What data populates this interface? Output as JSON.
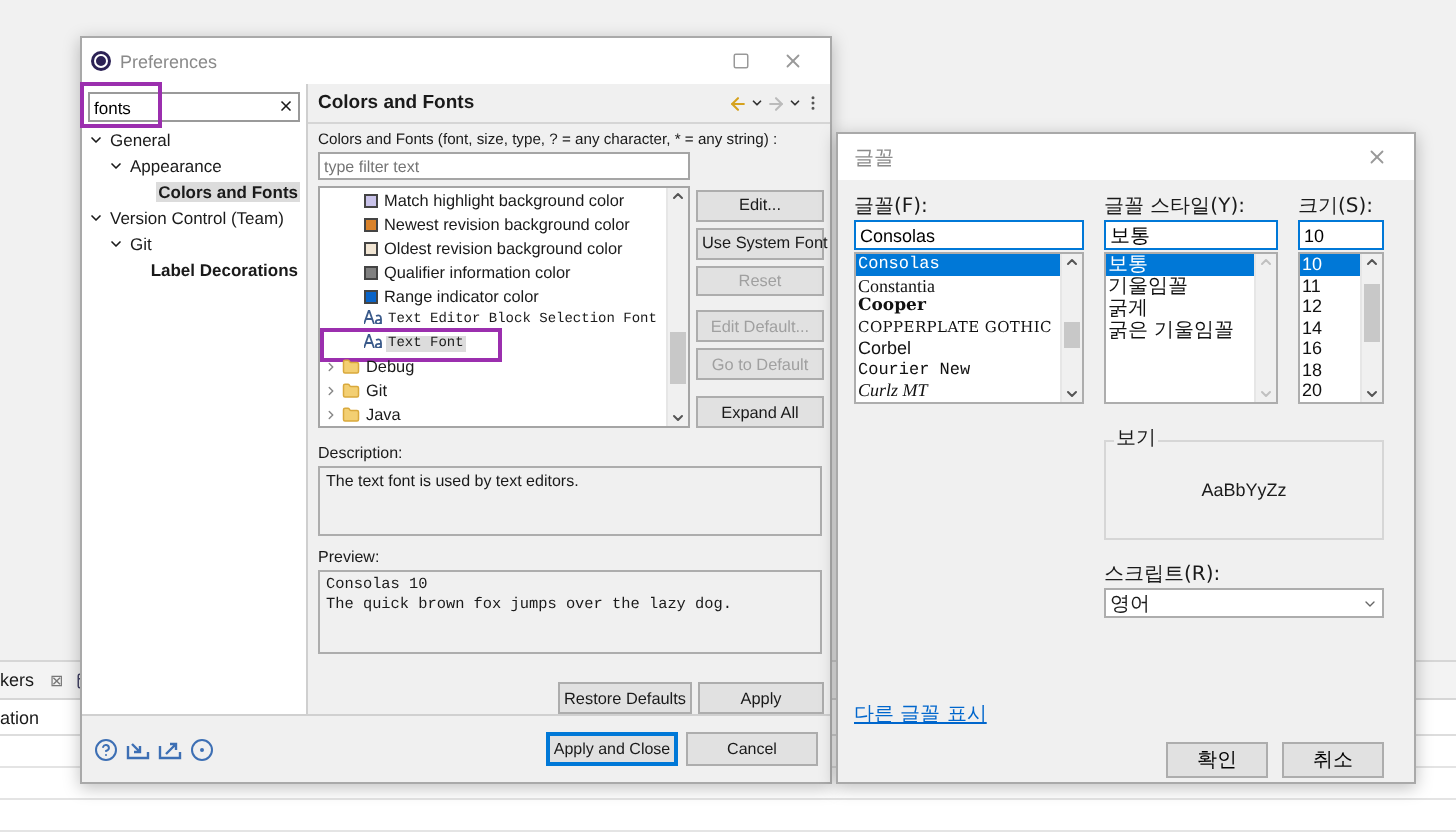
{
  "background": {
    "view_tab": {
      "label": "kers",
      "close": "⊠"
    },
    "table": {
      "columns": [
        "ation"
      ]
    }
  },
  "preferences": {
    "title": "Preferences",
    "search": {
      "value": "fonts",
      "highlighted": true
    },
    "nav_tree": [
      {
        "label": "General",
        "expanded": true,
        "children": [
          {
            "label": "Appearance",
            "expanded": true,
            "children": [
              {
                "label": "Colors and Fonts",
                "selected": true
              }
            ]
          }
        ]
      },
      {
        "label": "Version Control (Team)",
        "expanded": true,
        "children": [
          {
            "label": "Git",
            "expanded": true,
            "children": [
              {
                "label": "Label Decorations",
                "selected": false
              }
            ]
          }
        ]
      }
    ],
    "page_title": "Colors and Fonts",
    "instructions": "Colors and Fonts (font, size, type, ? = any character, * = any string) :",
    "filter": {
      "placeholder": "type filter text"
    },
    "items": [
      {
        "label": "Match highlight background color",
        "kind": "color",
        "color": "#c9c3ea",
        "selected": false,
        "highlighted": false
      },
      {
        "label": "Newest revision background color",
        "kind": "color",
        "color": "#d9822b",
        "selected": false,
        "highlighted": false
      },
      {
        "label": "Oldest revision background color",
        "kind": "color",
        "color": "#f2e6d4",
        "selected": false,
        "highlighted": false
      },
      {
        "label": "Qualifier information color",
        "kind": "color",
        "color": "#808080",
        "selected": false,
        "highlighted": false
      },
      {
        "label": "Range indicator color",
        "kind": "color",
        "color": "#0a64c8",
        "selected": false,
        "highlighted": false
      },
      {
        "label": "Text Editor Block Selection Font",
        "kind": "font",
        "selected": false,
        "highlighted": false
      },
      {
        "label": "Text Font",
        "kind": "font",
        "selected": true,
        "highlighted": true
      },
      {
        "label": "Debug",
        "kind": "category",
        "selected": false,
        "highlighted": false
      },
      {
        "label": "Git",
        "kind": "category",
        "selected": false,
        "highlighted": false
      },
      {
        "label": "Java",
        "kind": "category",
        "selected": false,
        "highlighted": false
      }
    ],
    "buttons": [
      {
        "label": "Edit...",
        "disabled": false
      },
      {
        "label": "Use System Font",
        "disabled": false
      },
      {
        "label": "Reset",
        "disabled": true
      },
      {
        "label": "Edit Default...",
        "disabled": true
      },
      {
        "label": "Go to Default",
        "disabled": true
      },
      {
        "label": "Expand All",
        "disabled": false
      }
    ],
    "description": {
      "label": "Description:",
      "text": "The text font is used by text editors."
    },
    "preview": {
      "label": "Preview:",
      "lines": [
        "Consolas 10",
        "The quick brown fox jumps over the lazy dog."
      ]
    },
    "page_buttons": [
      "Restore Defaults",
      "Apply"
    ],
    "dialog_buttons": [
      {
        "label": "Apply and Close",
        "default": true
      },
      {
        "label": "Cancel",
        "default": false
      }
    ]
  },
  "font_dialog": {
    "title": "글꼴",
    "font": {
      "label": "글꼴(F):",
      "value": "Consolas",
      "options": [
        {
          "label": "Consolas",
          "kind": "mono",
          "selected": true
        },
        {
          "label": "Constantia",
          "kind": "serif",
          "selected": false
        },
        {
          "label": "Cooper",
          "kind": "heavy",
          "selected": false
        },
        {
          "label": "COPPERPLATE GOTHIC",
          "kind": "wide",
          "selected": false
        },
        {
          "label": "Corbel",
          "kind": "sans",
          "selected": false
        },
        {
          "label": "Courier New",
          "kind": "mono",
          "selected": false
        },
        {
          "label": "Curlz MT",
          "kind": "script",
          "selected": false
        }
      ]
    },
    "style": {
      "label": "글꼴 스타일(Y):",
      "value": "보통",
      "options": [
        {
          "label": "보통",
          "selected": true
        },
        {
          "label": "기울임꼴",
          "selected": false
        },
        {
          "label": "굵게",
          "selected": false
        },
        {
          "label": "굵은 기울임꼴",
          "selected": false
        }
      ]
    },
    "size": {
      "label": "크기(S):",
      "value": "10",
      "options": [
        {
          "label": "10",
          "selected": true
        },
        {
          "label": "11",
          "selected": false
        },
        {
          "label": "12",
          "selected": false
        },
        {
          "label": "14",
          "selected": false
        },
        {
          "label": "16",
          "selected": false
        },
        {
          "label": "18",
          "selected": false
        },
        {
          "label": "20",
          "selected": false
        }
      ]
    },
    "sample": {
      "label": "보기",
      "text": "AaBbYyZz"
    },
    "script": {
      "label": "스크립트(R):",
      "value": "영어"
    },
    "more_fonts_link": "다른 글꼴 표시",
    "buttons": [
      "확인",
      "취소"
    ]
  }
}
